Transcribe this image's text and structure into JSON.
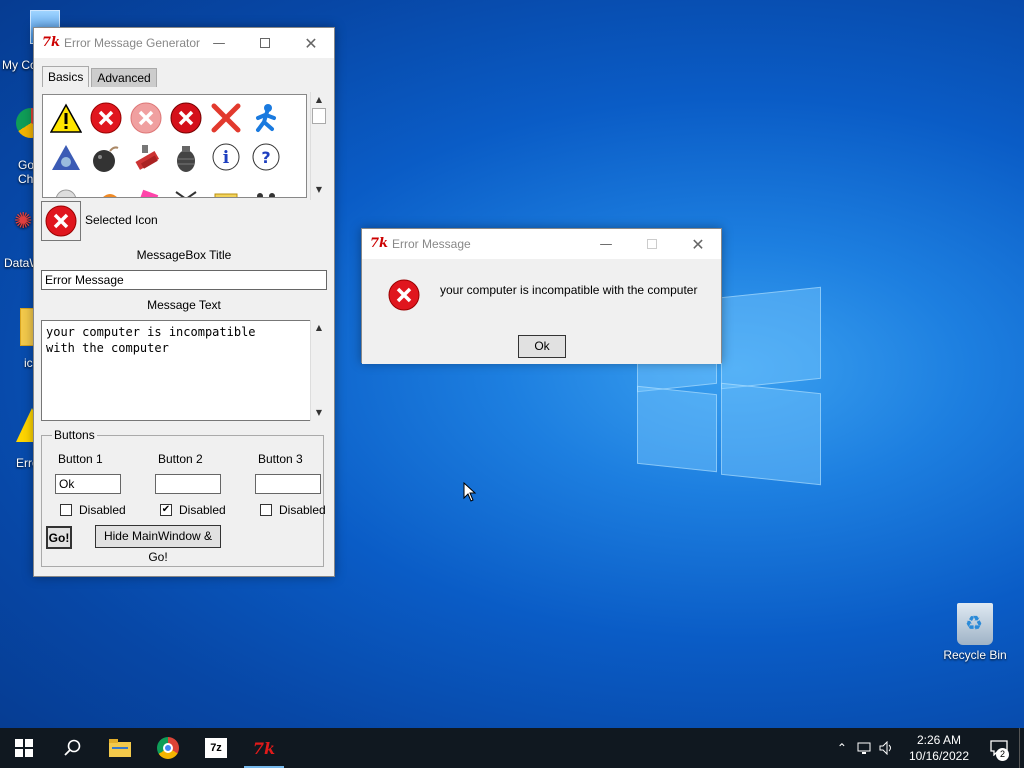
{
  "desktop": {
    "icons": [
      {
        "label": "My Co"
      },
      {
        "label": "Go Ch"
      },
      {
        "label": "DataW"
      },
      {
        "label": "ic"
      },
      {
        "label": "Erro"
      },
      {
        "label": "Recycle Bin"
      }
    ]
  },
  "generator": {
    "title": "Error Message Generator",
    "tabs": [
      {
        "label": "Basics"
      },
      {
        "label": "Advanced"
      }
    ],
    "selected_icon_label": "Selected Icon",
    "msgbox_title_label": "MessageBox Title",
    "msgbox_title_value": "Error Message",
    "message_text_label": "Message Text",
    "message_text_value": "your computer is incompatible\nwith the computer",
    "buttons_group_label": "Buttons",
    "button1": {
      "label": "Button 1",
      "value": "Ok",
      "disabled_label": "Disabled",
      "disabled": false
    },
    "button2": {
      "label": "Button 2",
      "value": "",
      "disabled_label": "Disabled",
      "disabled": true
    },
    "button3": {
      "label": "Button 3",
      "value": "",
      "disabled_label": "Disabled",
      "disabled": false
    },
    "go_label": "Go!",
    "hide_go_label": "Hide MainWindow & Go!"
  },
  "error_dialog": {
    "title": "Error Message",
    "message": "your computer is incompatible with the computer",
    "ok_label": "Ok"
  },
  "taskbar": {
    "time": "2:26 AM",
    "date": "10/16/2022",
    "notification_count": "2"
  },
  "colors": {
    "error_red": "#e0161e",
    "taskbar": "#101820",
    "desktop_blue": "#0a5cc6"
  }
}
